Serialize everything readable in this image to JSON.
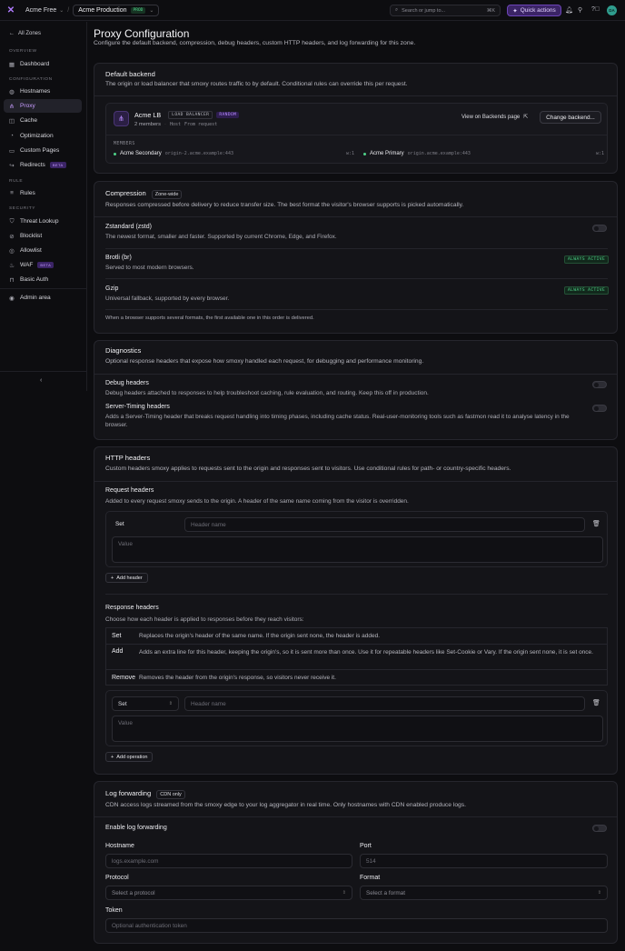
{
  "topbar": {
    "logo": "✕",
    "org": "Acme Free",
    "zone": "Acme Production",
    "env_badge": "PROD",
    "search_placeholder": "Search or jump to...",
    "search_shortcut": "⌘K",
    "quick_actions": "Quick actions",
    "avatar": "DA"
  },
  "sidebar": {
    "back": "All Zones",
    "sections": {
      "overview": "OVERVIEW",
      "configuration": "CONFIGURATION",
      "rule": "RULE",
      "security": "SECURITY"
    },
    "items": {
      "dashboard": "Dashboard",
      "hostnames": "Hostnames",
      "proxy": "Proxy",
      "cache": "Cache",
      "optimization": "Optimization",
      "custom_pages": "Custom Pages",
      "redirects": "Redirects",
      "rules": "Rules",
      "threat_lookup": "Threat Lookup",
      "blocklist": "Blocklist",
      "allowlist": "Allowlist",
      "waf": "WAF",
      "basic_auth": "Basic Auth",
      "admin_area": "Admin area"
    },
    "beta_label": "BETA"
  },
  "page": {
    "title": "Proxy Configuration",
    "subtitle": "Configure the default backend, compression, debug headers, custom HTTP headers, and log forwarding for this zone."
  },
  "backend": {
    "title": "Default backend",
    "subtitle": "The origin or load balancer that smoxy routes traffic to by default. Conditional rules can override this per request.",
    "name": "Acme LB",
    "type_badge": "LOAD BALANCER",
    "mode_badge": "RANDOM",
    "members_count": "2 members",
    "host_label": "Host",
    "host_value": "From request",
    "view_link": "View on Backends page",
    "change_button": "Change backend...",
    "members_heading": "MEMBERS",
    "members": [
      {
        "name": "Acme Secondary",
        "origin": "origin-2.acme.example:443",
        "weight": "w:1"
      },
      {
        "name": "Acme Primary",
        "origin": "origin.acme.example:443",
        "weight": "w:1"
      }
    ]
  },
  "compression": {
    "title": "Compression",
    "scope": "Zone-wide",
    "subtitle": "Responses compressed before delivery to reduce transfer size. The best format the visitor's browser supports is picked automatically.",
    "options": [
      {
        "title": "Zstandard (zstd)",
        "desc": "The newest format, smaller and faster. Supported by current Chrome, Edge, and Firefox.",
        "state": "toggle"
      },
      {
        "title": "Brotli (br)",
        "desc": "Served to most modern browsers.",
        "state": "ALWAYS ACTIVE"
      },
      {
        "title": "Gzip",
        "desc": "Universal fallback, supported by every browser.",
        "state": "ALWAYS ACTIVE"
      }
    ],
    "footnote": "When a browser supports several formats, the first available one in this order is delivered."
  },
  "diagnostics": {
    "title": "Diagnostics",
    "subtitle": "Optional response headers that expose how smoxy handled each request, for debugging and performance monitoring.",
    "debug_title": "Debug headers",
    "debug_desc": "Debug headers attached to responses to help troubleshoot caching, rule evaluation, and routing. Keep this off in production.",
    "timing_title": "Server-Timing headers",
    "timing_desc": "Adds a Server-Timing header that breaks request handling into timing phases, including cache status. Real-user-monitoring tools such as fastmon read it to analyse latency in the browser."
  },
  "http_headers": {
    "title": "HTTP headers",
    "subtitle": "Custom headers smoxy applies to requests sent to the origin and responses sent to visitors. Use conditional rules for path- or country-specific headers.",
    "request_title": "Request headers",
    "request_desc": "Added to every request smoxy sends to the origin. A header of the same name coming from the visitor is overridden.",
    "request_op": "Set",
    "header_name_placeholder": "Header name",
    "value_placeholder": "Value",
    "add_header": "Add header",
    "response_title": "Response headers",
    "response_desc": "Choose how each header is applied to responses before they reach visitors:",
    "ops": [
      {
        "name": "Set",
        "desc": "Replaces the origin's header of the same name. If the origin sent none, the header is added."
      },
      {
        "name": "Add",
        "desc": "Adds an extra line for this header, keeping the origin's, so it is sent more than once. Use it for repeatable headers like Set-Cookie or Vary. If the origin sent none, it is set once."
      },
      {
        "name": "Remove",
        "desc": "Removes the header from the origin's response, so visitors never receive it."
      }
    ],
    "response_op": "Set",
    "add_operation": "Add operation"
  },
  "log_forwarding": {
    "title": "Log forwarding",
    "scope": "CDN only",
    "subtitle": "CDN access logs streamed from the smoxy edge to your log aggregator in real time. Only hostnames with CDN enabled produce logs.",
    "enable_label": "Enable log forwarding",
    "hostname_label": "Hostname",
    "hostname_placeholder": "logs.example.com",
    "port_label": "Port",
    "port_placeholder": "514",
    "protocol_label": "Protocol",
    "protocol_placeholder": "Select a protocol",
    "format_label": "Format",
    "format_placeholder": "Select a format",
    "token_label": "Token",
    "token_placeholder": "Optional authentication token"
  }
}
